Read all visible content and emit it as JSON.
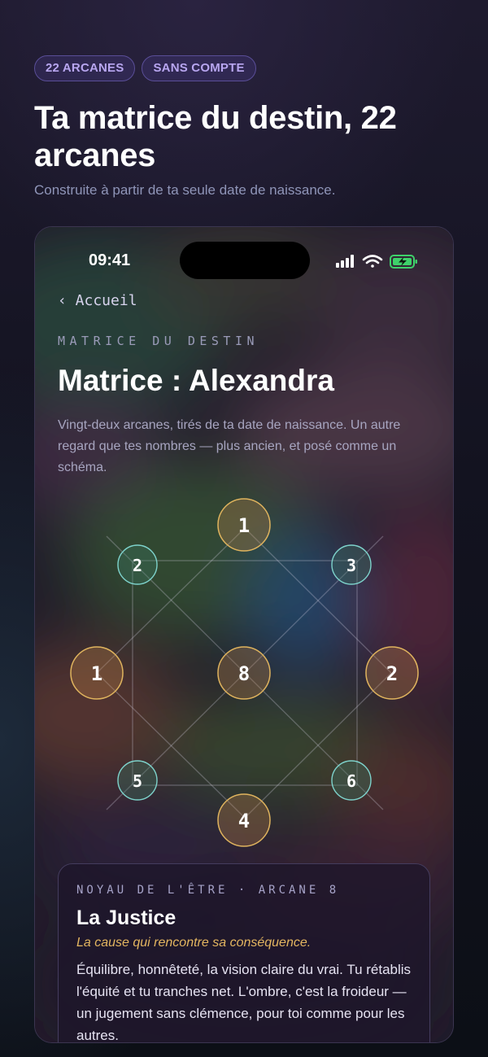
{
  "badges": [
    "22 ARCANES",
    "SANS COMPTE"
  ],
  "hero": {
    "title": "Ta matrice du destin, 22 arcanes",
    "subtitle": "Construite à partir de ta seule date de naissance."
  },
  "phone": {
    "status": {
      "time": "09:41",
      "icons": [
        "signal-icon",
        "wifi-icon",
        "battery-charging-icon"
      ]
    },
    "back_label": "‹ Accueil",
    "eyebrow": "MATRICE DU DESTIN",
    "title": "Matrice : Alexandra",
    "description": "Vingt-deux arcanes, tirés de ta date de naissance. Un autre regard que tes nombres — plus ancien, et posé comme un schéma.",
    "matrix": {
      "top": "1",
      "left": "1",
      "center": "8",
      "right": "2",
      "bottom": "4",
      "top_left": "2",
      "top_right": "3",
      "bottom_left": "5",
      "bottom_right": "6"
    },
    "card": {
      "eyebrow": "NOYAU DE L'ÊTRE · ARCANE 8",
      "title": "La Justice",
      "tagline": "La cause qui rencontre sa conséquence.",
      "body": "Équilibre, honnêteté, la vision claire du vrai. Tu rétablis l'équité et tu tranches net. L'ombre, c'est la froideur — un jugement sans clémence, pour toi comme pour les autres."
    }
  },
  "colors": {
    "accent": "#b8a6f0",
    "gold": "#e3b560",
    "teal": "#7ed3cc"
  }
}
